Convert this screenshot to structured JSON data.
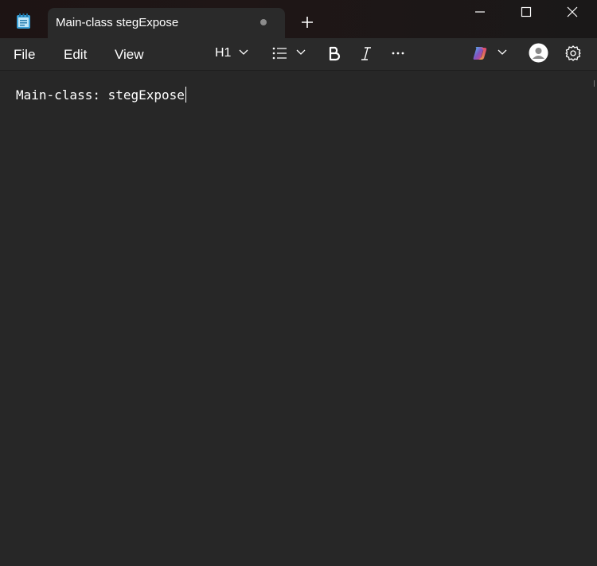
{
  "window": {
    "tab_title": "Main-class stegExpose",
    "unsaved_indicator": "unsaved-dot"
  },
  "icons": {
    "app": "notepad-icon",
    "new_tab": "plus-icon",
    "minimize": "minimize-icon",
    "maximize": "maximize-icon",
    "close": "close-icon",
    "list": "bulleted-list-icon",
    "bold": "bold-icon",
    "italic": "italic-icon",
    "more": "more-options-icon",
    "copilot": "copilot-icon",
    "account": "account-icon",
    "settings": "gear-icon"
  },
  "menu": {
    "file": "File",
    "edit": "Edit",
    "view": "View"
  },
  "toolbar": {
    "heading": "H1"
  },
  "editor": {
    "content": "Main-class: stegExpose"
  },
  "colors": {
    "background": "#272727",
    "titlebar": "#1d1414",
    "text": "#ffffff",
    "accent_icon": "#4fc3f7"
  }
}
